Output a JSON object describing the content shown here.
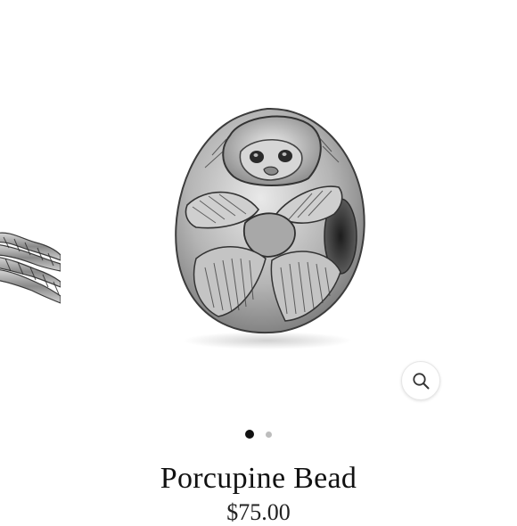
{
  "product": {
    "title": "Porcupine Bead",
    "price": "$75.00"
  },
  "gallery": {
    "slides": [
      {
        "subject": "porcupine-bead"
      },
      {
        "subject": "bracelet-chain"
      }
    ],
    "active_slide": 0,
    "zoom_icon": "magnifier-icon"
  },
  "colors": {
    "background": "#ffffff",
    "silver": "#b9b9b9",
    "dark_silver": "#3e3e3e",
    "dot_active": "#111111",
    "dot_inactive": "#bdbdbd"
  }
}
